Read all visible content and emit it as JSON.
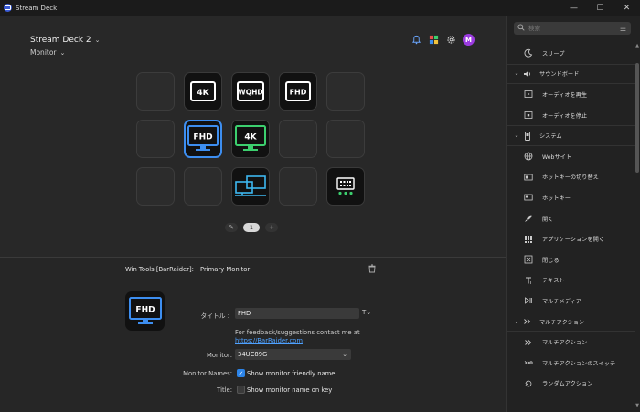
{
  "window": {
    "title": "Stream Deck",
    "minimize": "—",
    "maximize": "☐",
    "close": "✕"
  },
  "header": {
    "device": "Stream Deck 2",
    "profile": "Monitor",
    "avatar": "M"
  },
  "keys": [
    {
      "row": 0,
      "col": 0,
      "label": ""
    },
    {
      "row": 0,
      "col": 1,
      "label": "4K"
    },
    {
      "row": 0,
      "col": 2,
      "label": "WQHD"
    },
    {
      "row": 0,
      "col": 3,
      "label": "FHD"
    },
    {
      "row": 0,
      "col": 4,
      "label": ""
    },
    {
      "row": 1,
      "col": 0,
      "label": ""
    },
    {
      "row": 1,
      "col": 1,
      "label": "FHD"
    },
    {
      "row": 1,
      "col": 2,
      "label": "4K"
    },
    {
      "row": 1,
      "col": 3,
      "label": ""
    },
    {
      "row": 1,
      "col": 4,
      "label": ""
    },
    {
      "row": 2,
      "col": 0,
      "label": ""
    },
    {
      "row": 2,
      "col": 1,
      "label": ""
    },
    {
      "row": 2,
      "col": 2,
      "label": ""
    },
    {
      "row": 2,
      "col": 3,
      "label": ""
    },
    {
      "row": 2,
      "col": 4,
      "label": ""
    }
  ],
  "pager": {
    "page": "1",
    "add": "+"
  },
  "inspector": {
    "plugin": "Win Tools [BarRaider]:",
    "action": "Primary Monitor",
    "preview_label": "FHD",
    "title_label": "タイトル :",
    "title_value": "FHD",
    "feedback": "For feedback/suggestions contact me at",
    "link": "https://BarRaider.com",
    "monitor_label": "Monitor:",
    "monitor_value": "34UC89G",
    "monitor_names_label": "Monitor Names:",
    "monitor_names_text": "Show monitor friendly name",
    "title2_label": "Title:",
    "title2_text": "Show monitor name on key"
  },
  "sidebar": {
    "search_placeholder": "検索",
    "rows": [
      {
        "type": "item",
        "label": "スリープ",
        "icon": "moon-icon"
      },
      {
        "type": "cat",
        "label": "サウンドボード",
        "icon": "speaker-icon"
      },
      {
        "type": "item",
        "label": "オーディオを再生",
        "icon": "play-icon"
      },
      {
        "type": "item",
        "label": "オーディオを停止",
        "icon": "stop-icon"
      },
      {
        "type": "cat",
        "label": "システム",
        "icon": "phone-icon"
      },
      {
        "type": "item",
        "label": "Webサイト",
        "icon": "globe-icon"
      },
      {
        "type": "item",
        "label": "ホットキーの切り替え",
        "icon": "toggle-icon"
      },
      {
        "type": "item",
        "label": "ホットキー",
        "icon": "keyboard-icon"
      },
      {
        "type": "item",
        "label": "開く",
        "icon": "rocket-icon"
      },
      {
        "type": "item",
        "label": "アプリケーションを開く",
        "icon": "grid-icon"
      },
      {
        "type": "item",
        "label": "閉じる",
        "icon": "close-box-icon"
      },
      {
        "type": "item",
        "label": "テキスト",
        "icon": "text-icon"
      },
      {
        "type": "item",
        "label": "マルチメディア",
        "icon": "media-icon"
      },
      {
        "type": "cat",
        "label": "マルチアクション",
        "icon": "multi-icon"
      },
      {
        "type": "item",
        "label": "マルチアクション",
        "icon": "multi-action-icon"
      },
      {
        "type": "item",
        "label": "マルチアクションのスイッチ",
        "icon": "multi-switch-icon"
      },
      {
        "type": "item",
        "label": "ランダムアクション",
        "icon": "random-icon"
      }
    ]
  },
  "colors": {
    "accent": "#3d8ef0",
    "green": "#3ccf6e",
    "link": "#4ea1ff",
    "avatar": "#9b3be0"
  }
}
